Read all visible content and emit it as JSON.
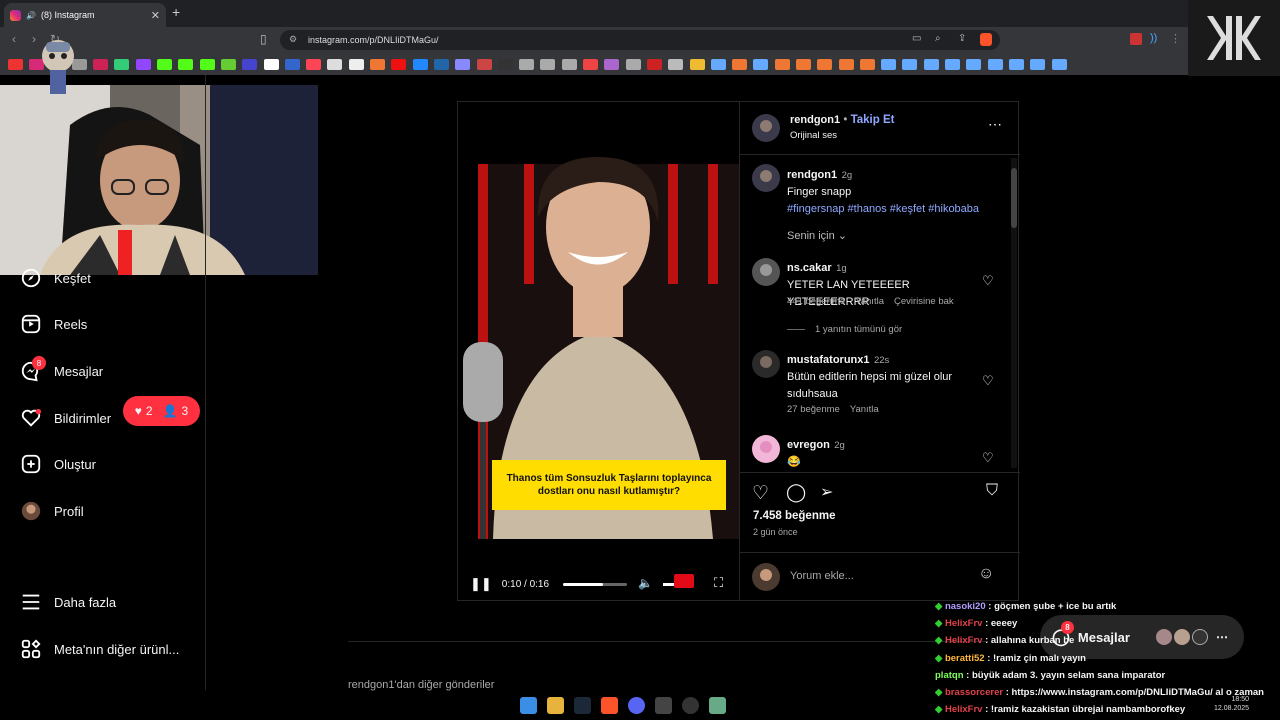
{
  "browser": {
    "tab_title": "(8) Instagram",
    "url": "instagram.com/p/DNLIiDTMaGu/"
  },
  "sidebar": {
    "items": [
      {
        "label": "Keşfet"
      },
      {
        "label": "Reels"
      },
      {
        "label": "Mesajlar",
        "badge": "8"
      },
      {
        "label": "Bildirimler"
      },
      {
        "label": "Oluştur"
      },
      {
        "label": "Profil"
      },
      {
        "label": "Daha fazla"
      },
      {
        "label": "Meta'nın diğer ürünl..."
      }
    ],
    "notif_likes": "2",
    "notif_follows": "3"
  },
  "post": {
    "author": "rendgon1",
    "follow_label": "Takip Et",
    "dot": "•",
    "audio": "Orijinal ses",
    "caption_author": "rendgon1",
    "caption_time": "2g",
    "caption_text": "Finger snapp",
    "caption_tags": "#fingersnap #thanos #keşfet #hikobaba",
    "filter_label": "Senin için",
    "comments": [
      {
        "user": "ns.cakar",
        "time": "1g",
        "text": "YETER LAN YETEEEER YETEEEERRRR",
        "likes": "441 beğenme",
        "reply": "Yanıtla",
        "translate": "Çevirisine bak"
      },
      {
        "user": "mustafatorunx1",
        "time": "22s",
        "text": "Bütün editlerin hepsi mi güzel olur sıduhsaua",
        "likes": "27 beğenme",
        "reply": "Yanıtla"
      },
      {
        "user": "evregon",
        "time": "2g",
        "text": "😂"
      }
    ],
    "view_replies": "1 yanıtın tümünü gör",
    "likes": "7.458 beğenme",
    "posted": "2 gün önce",
    "comment_placeholder": "Yorum ekle...",
    "video_subtitle": "Thanos tüm Sonsuzluk Taşlarını toplayınca dostları onu nasıl kutlamıştır?",
    "video_time": "0:10 / 0:16",
    "video_progress": 0.625
  },
  "more_posts": "rendgon1'dan diğer gönderiler",
  "messages_pill": {
    "label": "Mesajlar",
    "badge": "8"
  },
  "chat": [
    {
      "user": "nasoki20",
      "color": "#b39cff",
      "msg": " : göçmen şube + ice bu artık"
    },
    {
      "user": "HelixFrv",
      "color": "#e0424a",
      "msg": " : eeeey"
    },
    {
      "user": "HelixFrv",
      "color": "#e0424a",
      "msg": " : allahına kurban be"
    },
    {
      "user": "beratti52",
      "color": "#ffb63b",
      "msg": " : !ramiz çin malı yayın"
    },
    {
      "user": "platqn",
      "color": "#7fff5a",
      "msg": " : büyük adam 3. yayın selam sana imparator"
    },
    {
      "user": "brassorcerer",
      "color": "#e0424a",
      "msg": " : https://www.instagram.com/p/DNLIiDTMaGu/ al o zaman"
    },
    {
      "user": "HelixFrv",
      "color": "#e0424a",
      "msg": " : !ramiz kazakistan übrejai nambamborofkey"
    }
  ],
  "clock": {
    "time": "18:50",
    "date": "12.08.2025"
  },
  "colors": {
    "accent": "#0095f6",
    "link": "#8fa8ff",
    "badge": "#ff3040"
  }
}
